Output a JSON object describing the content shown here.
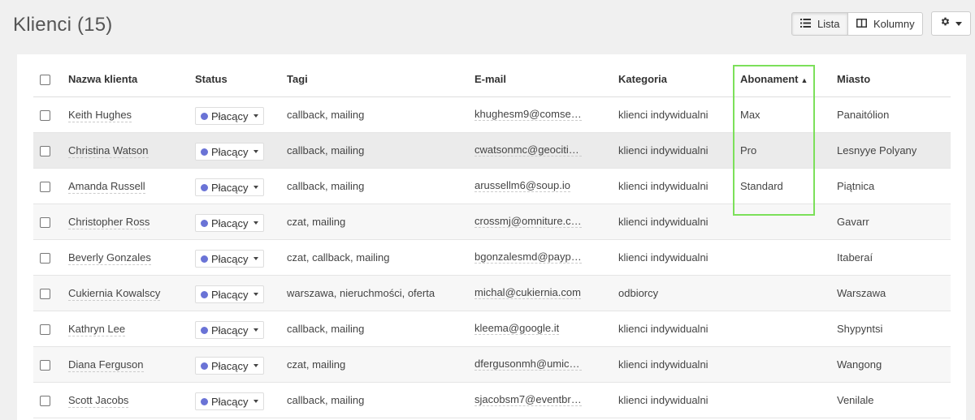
{
  "page": {
    "title": "Klienci (15)"
  },
  "toolbar": {
    "list_label": "Lista",
    "columns_label": "Kolumny"
  },
  "table": {
    "headers": {
      "name": "Nazwa klienta",
      "status": "Status",
      "tags": "Tagi",
      "email": "E-mail",
      "category": "Kategoria",
      "subscription": "Abonament",
      "subscription_sort": "▲",
      "city": "Miasto"
    },
    "rows": [
      {
        "name": "Keith Hughes",
        "status": "Płacący",
        "tags": "callback, mailing",
        "email": "khughesm9@comsen...",
        "category": "klienci indywidualni",
        "subscription": "Max",
        "city": "Panaitólion"
      },
      {
        "name": "Christina Watson",
        "status": "Płacący",
        "tags": "callback, mailing",
        "email": "cwatsonmc@geocitie...",
        "category": "klienci indywidualni",
        "subscription": "Pro",
        "city": "Lesnyye Polyany"
      },
      {
        "name": "Amanda Russell",
        "status": "Płacący",
        "tags": "callback, mailing",
        "email": "arussellm6@soup.io",
        "category": "klienci indywidualni",
        "subscription": "Standard",
        "city": "Piątnica"
      },
      {
        "name": "Christopher Ross",
        "status": "Płacący",
        "tags": "czat, mailing",
        "email": "crossmj@omniture.co...",
        "category": "klienci indywidualni",
        "subscription": "",
        "city": "Gavarr"
      },
      {
        "name": "Beverly Gonzales",
        "status": "Płacący",
        "tags": "czat, callback, mailing",
        "email": "bgonzalesmd@paypal...",
        "category": "klienci indywidualni",
        "subscription": "",
        "city": "Itaberaí"
      },
      {
        "name": "Cukiernia Kowalscy",
        "status": "Płacący",
        "tags": "warszawa, nieruchmości, oferta",
        "email": "michal@cukiernia.com",
        "category": "odbiorcy",
        "subscription": "",
        "city": "Warszawa"
      },
      {
        "name": "Kathryn Lee",
        "status": "Płacący",
        "tags": "callback, mailing",
        "email": "kleema@google.it",
        "category": "klienci indywidualni",
        "subscription": "",
        "city": "Shypyntsi"
      },
      {
        "name": "Diana Ferguson",
        "status": "Płacący",
        "tags": "czat, mailing",
        "email": "dfergusonmh@umich...",
        "category": "klienci indywidualni",
        "subscription": "",
        "city": "Wangong"
      },
      {
        "name": "Scott Jacobs",
        "status": "Płacący",
        "tags": "callback, mailing",
        "email": "sjacobsm7@eventbrit...",
        "category": "klienci indywidualni",
        "subscription": "",
        "city": "Venilale"
      }
    ]
  },
  "colors": {
    "status_dot": "#6a73d6",
    "highlight": "#7ce05a"
  },
  "icons": {
    "list": "list-icon",
    "columns": "columns-icon",
    "settings": "gear-icon"
  }
}
